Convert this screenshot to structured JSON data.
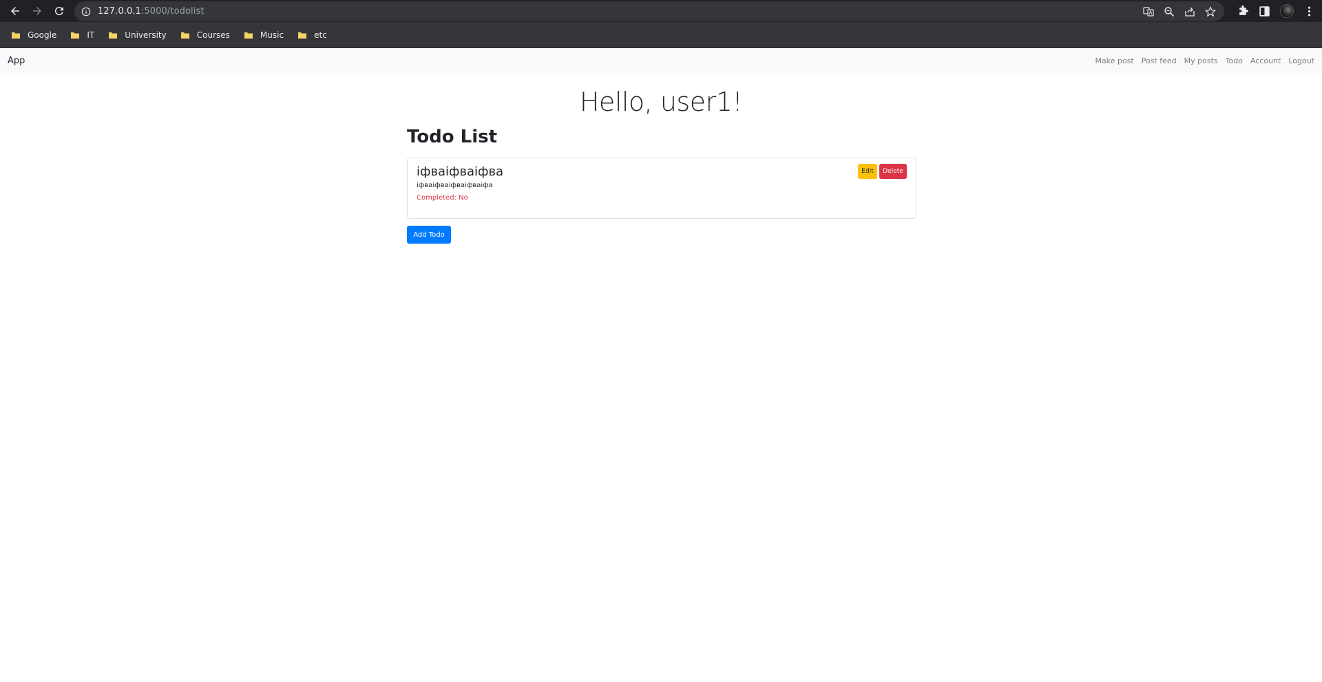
{
  "browser": {
    "url_host": "127.0.0.1",
    "url_rest": ":5000/todolist",
    "bookmarks": [
      {
        "label": "Google"
      },
      {
        "label": "IT"
      },
      {
        "label": "University"
      },
      {
        "label": "Courses"
      },
      {
        "label": "Music"
      },
      {
        "label": "etc"
      }
    ],
    "folder_color": "#f6d365"
  },
  "navbar": {
    "brand": "App",
    "links": [
      "Make post",
      "Post feed",
      "My posts",
      "Todo",
      "Account",
      "Logout"
    ]
  },
  "page": {
    "greeting": "Hello, user1!",
    "title": "Todo List",
    "todos": [
      {
        "title": "іфваіфваіфва",
        "description": "іфваіфваіфваіфваіфа",
        "status": "Completed: No",
        "edit_label": "Edit",
        "delete_label": "Delete"
      }
    ],
    "add_label": "Add Todo"
  },
  "colors": {
    "primary": "#007bff",
    "warning": "#ffc107",
    "danger": "#dc3545"
  }
}
